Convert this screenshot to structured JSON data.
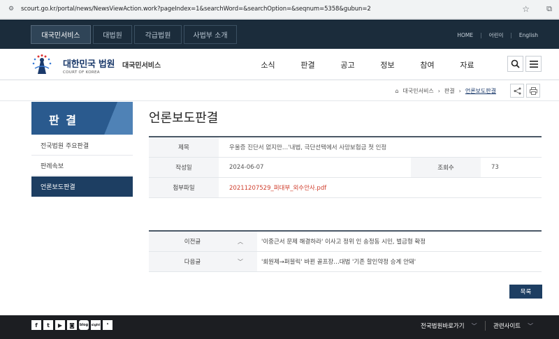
{
  "browser": {
    "url": "scourt.go.kr/portal/news/NewsViewAction.work?pageIndex=1&searchWord=&searchOption=&seqnum=5358&gubun=2"
  },
  "topbar": {
    "tabs": [
      "대국민서비스",
      "대법원",
      "각급법원",
      "사법부 소개"
    ],
    "links": [
      "HOME",
      "어린이",
      "English"
    ]
  },
  "header": {
    "logo_ko": "대한민국 법원",
    "logo_en": "COURT OF KOREA",
    "subtitle": "대국민서비스",
    "nav": [
      "소식",
      "판결",
      "공고",
      "정보",
      "참여",
      "자료"
    ]
  },
  "breadcrumb": {
    "items": [
      "대국민서비스",
      "판결",
      "언론보도판결"
    ]
  },
  "sidebar": {
    "title": "판 결",
    "items": [
      "전국법원 주요판결",
      "판례속보",
      "언론보도판결"
    ]
  },
  "page": {
    "title": "언론보도판결"
  },
  "article": {
    "title_label": "제목",
    "title": "우울증 진단서 없지만…'내법, 극단선택에서 사망보험금 첫 인정",
    "date_label": "작성일",
    "date": "2024-06-07",
    "views_label": "조회수",
    "views": "73",
    "attach_label": "첨부파일",
    "attach": "20211207529_퍼대부_외수안사.pdf"
  },
  "navlist": {
    "prev_label": "이전글",
    "prev": "'이중근서 문제 해결하라' 이사고 정위 인 송정동 시민, 벌금형 확정",
    "next_label": "다음글",
    "next": "'회원제→퍼블릭' 바뀐 골프장…대법 '기존 할인약정 승계 안돼'"
  },
  "buttons": {
    "list": "목록"
  },
  "footer": {
    "sns": [
      "f",
      "t",
      "▶",
      "◙",
      "blog",
      "sight",
      "❜"
    ],
    "select1": "전국법원바로가기",
    "select2": "관련사이트"
  }
}
